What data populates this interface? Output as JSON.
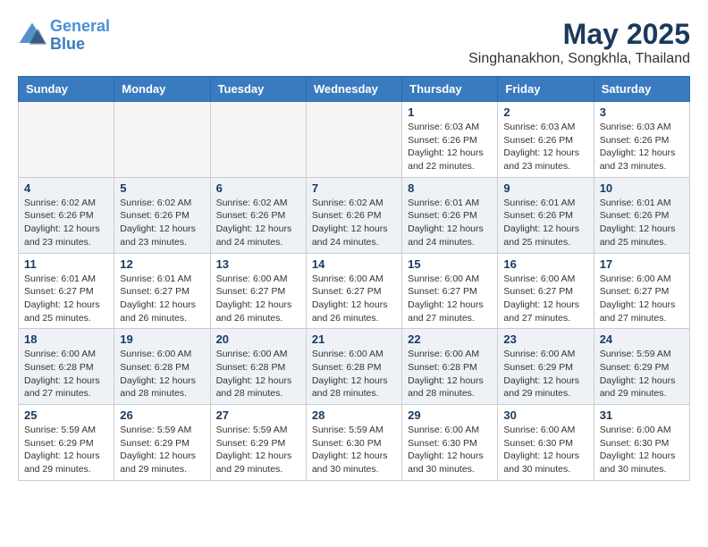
{
  "logo": {
    "line1": "General",
    "line2": "Blue"
  },
  "title": "May 2025",
  "location": "Singhanakhon, Songkhla, Thailand",
  "days_of_week": [
    "Sunday",
    "Monday",
    "Tuesday",
    "Wednesday",
    "Thursday",
    "Friday",
    "Saturday"
  ],
  "weeks": [
    {
      "row_style": "even",
      "days": [
        {
          "num": "",
          "info": ""
        },
        {
          "num": "",
          "info": ""
        },
        {
          "num": "",
          "info": ""
        },
        {
          "num": "",
          "info": ""
        },
        {
          "num": "1",
          "info": "Sunrise: 6:03 AM\nSunset: 6:26 PM\nDaylight: 12 hours\nand 22 minutes."
        },
        {
          "num": "2",
          "info": "Sunrise: 6:03 AM\nSunset: 6:26 PM\nDaylight: 12 hours\nand 23 minutes."
        },
        {
          "num": "3",
          "info": "Sunrise: 6:03 AM\nSunset: 6:26 PM\nDaylight: 12 hours\nand 23 minutes."
        }
      ]
    },
    {
      "row_style": "odd",
      "days": [
        {
          "num": "4",
          "info": "Sunrise: 6:02 AM\nSunset: 6:26 PM\nDaylight: 12 hours\nand 23 minutes."
        },
        {
          "num": "5",
          "info": "Sunrise: 6:02 AM\nSunset: 6:26 PM\nDaylight: 12 hours\nand 23 minutes."
        },
        {
          "num": "6",
          "info": "Sunrise: 6:02 AM\nSunset: 6:26 PM\nDaylight: 12 hours\nand 24 minutes."
        },
        {
          "num": "7",
          "info": "Sunrise: 6:02 AM\nSunset: 6:26 PM\nDaylight: 12 hours\nand 24 minutes."
        },
        {
          "num": "8",
          "info": "Sunrise: 6:01 AM\nSunset: 6:26 PM\nDaylight: 12 hours\nand 24 minutes."
        },
        {
          "num": "9",
          "info": "Sunrise: 6:01 AM\nSunset: 6:26 PM\nDaylight: 12 hours\nand 25 minutes."
        },
        {
          "num": "10",
          "info": "Sunrise: 6:01 AM\nSunset: 6:26 PM\nDaylight: 12 hours\nand 25 minutes."
        }
      ]
    },
    {
      "row_style": "even",
      "days": [
        {
          "num": "11",
          "info": "Sunrise: 6:01 AM\nSunset: 6:27 PM\nDaylight: 12 hours\nand 25 minutes."
        },
        {
          "num": "12",
          "info": "Sunrise: 6:01 AM\nSunset: 6:27 PM\nDaylight: 12 hours\nand 26 minutes."
        },
        {
          "num": "13",
          "info": "Sunrise: 6:00 AM\nSunset: 6:27 PM\nDaylight: 12 hours\nand 26 minutes."
        },
        {
          "num": "14",
          "info": "Sunrise: 6:00 AM\nSunset: 6:27 PM\nDaylight: 12 hours\nand 26 minutes."
        },
        {
          "num": "15",
          "info": "Sunrise: 6:00 AM\nSunset: 6:27 PM\nDaylight: 12 hours\nand 27 minutes."
        },
        {
          "num": "16",
          "info": "Sunrise: 6:00 AM\nSunset: 6:27 PM\nDaylight: 12 hours\nand 27 minutes."
        },
        {
          "num": "17",
          "info": "Sunrise: 6:00 AM\nSunset: 6:27 PM\nDaylight: 12 hours\nand 27 minutes."
        }
      ]
    },
    {
      "row_style": "odd",
      "days": [
        {
          "num": "18",
          "info": "Sunrise: 6:00 AM\nSunset: 6:28 PM\nDaylight: 12 hours\nand 27 minutes."
        },
        {
          "num": "19",
          "info": "Sunrise: 6:00 AM\nSunset: 6:28 PM\nDaylight: 12 hours\nand 28 minutes."
        },
        {
          "num": "20",
          "info": "Sunrise: 6:00 AM\nSunset: 6:28 PM\nDaylight: 12 hours\nand 28 minutes."
        },
        {
          "num": "21",
          "info": "Sunrise: 6:00 AM\nSunset: 6:28 PM\nDaylight: 12 hours\nand 28 minutes."
        },
        {
          "num": "22",
          "info": "Sunrise: 6:00 AM\nSunset: 6:28 PM\nDaylight: 12 hours\nand 28 minutes."
        },
        {
          "num": "23",
          "info": "Sunrise: 6:00 AM\nSunset: 6:29 PM\nDaylight: 12 hours\nand 29 minutes."
        },
        {
          "num": "24",
          "info": "Sunrise: 5:59 AM\nSunset: 6:29 PM\nDaylight: 12 hours\nand 29 minutes."
        }
      ]
    },
    {
      "row_style": "even",
      "days": [
        {
          "num": "25",
          "info": "Sunrise: 5:59 AM\nSunset: 6:29 PM\nDaylight: 12 hours\nand 29 minutes."
        },
        {
          "num": "26",
          "info": "Sunrise: 5:59 AM\nSunset: 6:29 PM\nDaylight: 12 hours\nand 29 minutes."
        },
        {
          "num": "27",
          "info": "Sunrise: 5:59 AM\nSunset: 6:29 PM\nDaylight: 12 hours\nand 29 minutes."
        },
        {
          "num": "28",
          "info": "Sunrise: 5:59 AM\nSunset: 6:30 PM\nDaylight: 12 hours\nand 30 minutes."
        },
        {
          "num": "29",
          "info": "Sunrise: 6:00 AM\nSunset: 6:30 PM\nDaylight: 12 hours\nand 30 minutes."
        },
        {
          "num": "30",
          "info": "Sunrise: 6:00 AM\nSunset: 6:30 PM\nDaylight: 12 hours\nand 30 minutes."
        },
        {
          "num": "31",
          "info": "Sunrise: 6:00 AM\nSunset: 6:30 PM\nDaylight: 12 hours\nand 30 minutes."
        }
      ]
    }
  ]
}
